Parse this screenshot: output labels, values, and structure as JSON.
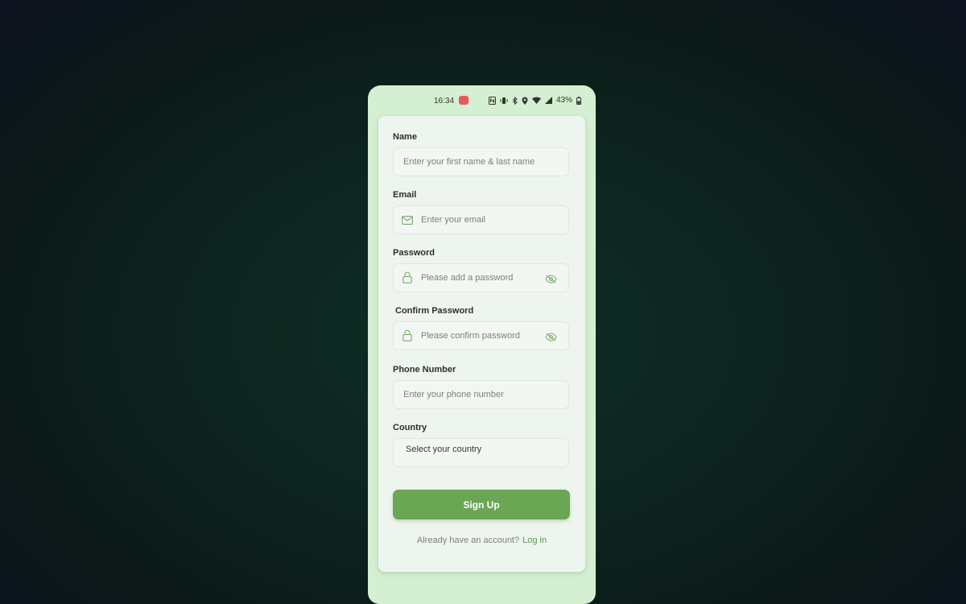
{
  "status_bar": {
    "time": "16:34",
    "battery": "43%"
  },
  "form": {
    "name": {
      "label": "Name",
      "placeholder": "Enter your first name & last name"
    },
    "email": {
      "label": "Email",
      "placeholder": "Enter your email"
    },
    "password": {
      "label": "Password",
      "placeholder": "Please add a password"
    },
    "confirm_password": {
      "label": "Confirm Password",
      "placeholder": "Please confirm password"
    },
    "phone": {
      "label": "Phone Number",
      "placeholder": "Enter your phone number"
    },
    "country": {
      "label": "Country",
      "selected": "Select your country"
    },
    "signup_label": "Sign Up",
    "login_prompt": "Already have an account?",
    "login_link": "Log in"
  },
  "colors": {
    "accent": "#6aa653",
    "phone_bg": "#d4efd1",
    "card_bg": "#eef5ee",
    "link": "#5a9a48"
  },
  "icons": {
    "email": "mail-icon",
    "password": "lock-icon",
    "visibility": "eye-off-icon"
  }
}
